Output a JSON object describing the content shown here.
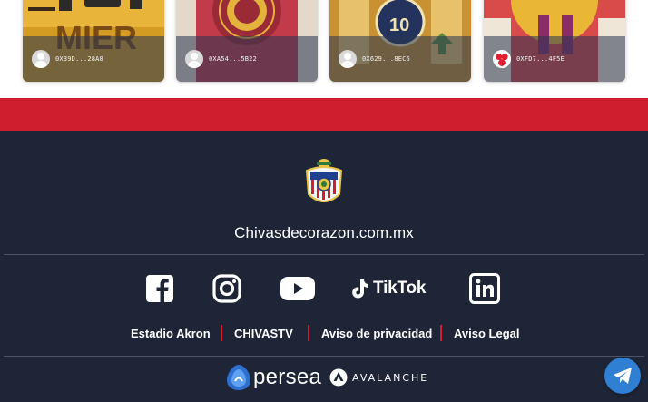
{
  "cards": [
    {
      "owner": "0X39D...28A8",
      "art_text": "MIER",
      "avatar": "default-avatar-icon"
    },
    {
      "owner": "0XA54...5B22",
      "art_text": "",
      "avatar": "default-avatar-icon"
    },
    {
      "owner": "0X629...8EC6",
      "art_text": "10",
      "avatar": "default-avatar-icon"
    },
    {
      "owner": "0XFD7...4F5E",
      "art_text": "",
      "avatar": "pattern-avatar-icon"
    }
  ],
  "footer": {
    "site": "Chivasdecorazon.com.mx",
    "social": [
      "facebook-icon",
      "instagram-icon",
      "youtube-icon",
      "tiktok-icon",
      "linkedin-icon"
    ],
    "tiktok_label": "TikTok",
    "links": [
      "Estadio Akron",
      "CHIVASTV",
      "Aviso de privacidad",
      "Aviso Legal"
    ],
    "partners": {
      "persea": "persea",
      "avalanche": "AVALANCHE"
    }
  },
  "colors": {
    "brand_red": "#cf1e2e",
    "footer_bg": "#1d2536",
    "telegram_blue": "#2f7fd4"
  }
}
